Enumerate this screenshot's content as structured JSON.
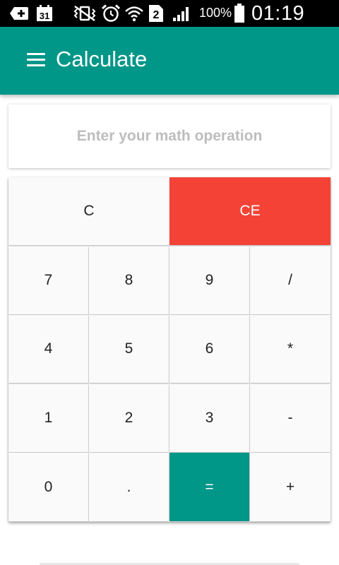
{
  "status_bar": {
    "battery": "100%",
    "time": "01:19 AM",
    "calendar_day": "31",
    "sim_number": "2",
    "icons": [
      "add-box-icon",
      "calendar-icon",
      "vibrate-icon",
      "alarm-icon",
      "wifi-icon",
      "sim-icon",
      "signal-icon",
      "battery-icon"
    ]
  },
  "app_bar": {
    "title": "Calculate",
    "menu_icon": "hamburger-menu-icon",
    "color": "#009688"
  },
  "input": {
    "value": "",
    "placeholder": "Enter your math operation"
  },
  "keypad": {
    "clear": {
      "label": "C"
    },
    "clear_entry": {
      "label": "CE",
      "color": "#F44336"
    },
    "rows": [
      [
        "7",
        "8",
        "9",
        "/"
      ],
      [
        "4",
        "5",
        "6",
        "*"
      ],
      [
        "1",
        "2",
        "3",
        "-"
      ],
      [
        "0",
        ".",
        "=",
        "+"
      ]
    ],
    "equals_color": "#009688"
  }
}
